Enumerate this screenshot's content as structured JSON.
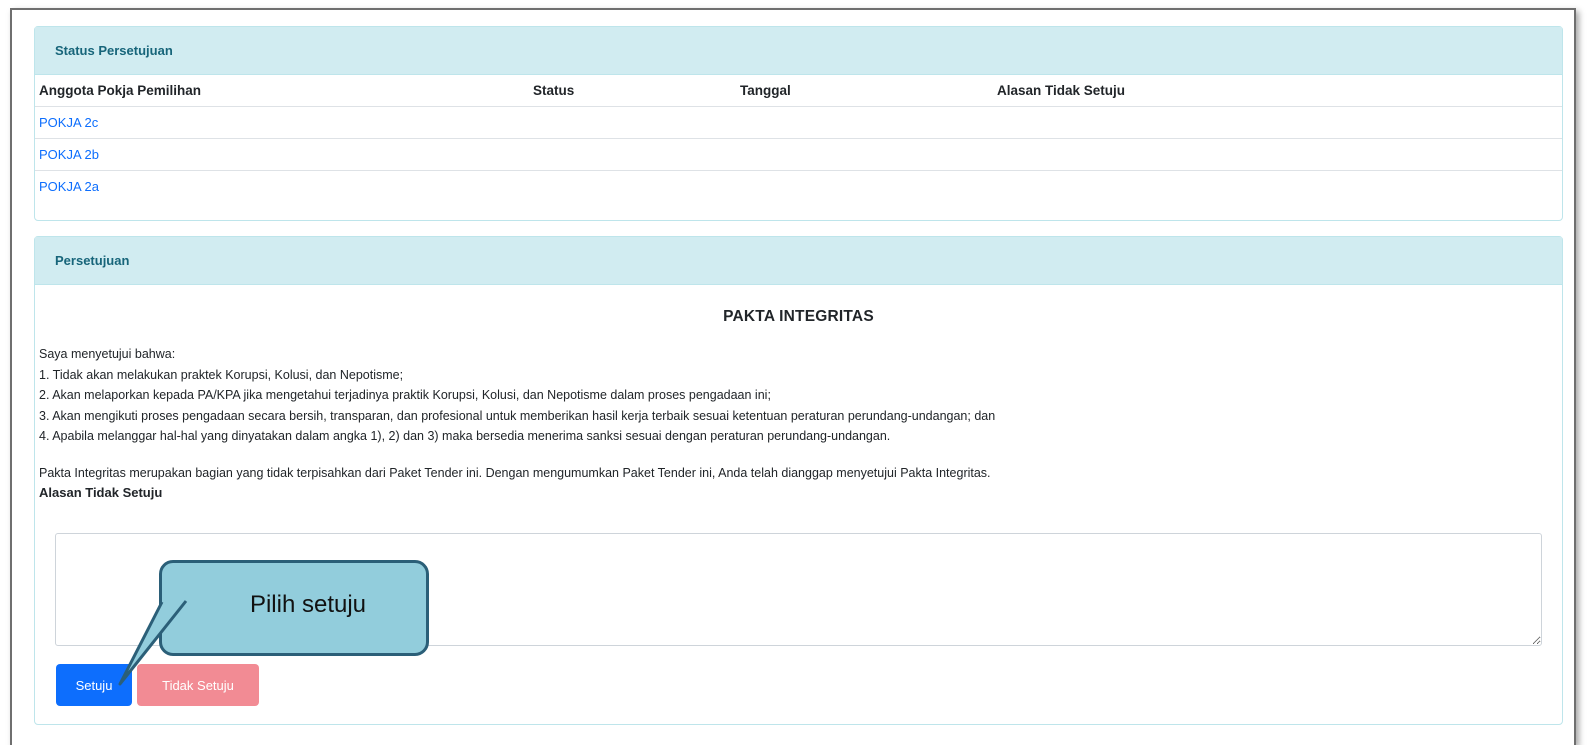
{
  "status_panel": {
    "title": "Status Persetujuan",
    "columns": [
      "Anggota Pokja Pemilihan",
      "Status",
      "Tanggal",
      "Alasan Tidak Setuju"
    ],
    "rows": [
      {
        "member": "POKJA 2c",
        "status": "",
        "date": "",
        "reason": ""
      },
      {
        "member": "POKJA 2b",
        "status": "",
        "date": "",
        "reason": ""
      },
      {
        "member": "POKJA 2a",
        "status": "",
        "date": "",
        "reason": ""
      }
    ]
  },
  "approval_panel": {
    "title": "Persetujuan",
    "pakta_title": "PAKTA INTEGRITAS",
    "lines": [
      "Saya menyetujui bahwa:",
      "1. Tidak akan melakukan praktek Korupsi, Kolusi, dan Nepotisme;",
      "2. Akan melaporkan kepada PA/KPA jika mengetahui terjadinya praktik Korupsi, Kolusi, dan Nepotisme dalam proses pengadaan ini;",
      "3. Akan mengikuti proses pengadaan secara bersih, transparan, dan profesional untuk memberikan hasil kerja terbaik sesuai ketentuan peraturan perundang-undangan; dan",
      "4. Apabila melanggar hal-hal yang dinyatakan dalam angka 1), 2) dan 3) maka bersedia menerima sanksi sesuai dengan peraturan perundang-undangan."
    ],
    "note": "Pakta Integritas merupakan bagian yang tidak terpisahkan dari Paket Tender ini. Dengan mengumumkan Paket Tender ini, Anda telah dianggap menyetujui Pakta Integritas.",
    "reason_label": "Alasan Tidak Setuju",
    "reason_value": "",
    "approve_label": "Setuju",
    "reject_label": "Tidak Setuju"
  },
  "callout": {
    "text": "Pilih setuju"
  },
  "colors": {
    "header_bg": "#d1ecf1",
    "header_text": "#17657a",
    "primary": "#0d6efd",
    "danger_disabled": "#f28b94",
    "callout_fill": "#92cddc",
    "callout_border": "#2b5f78"
  }
}
